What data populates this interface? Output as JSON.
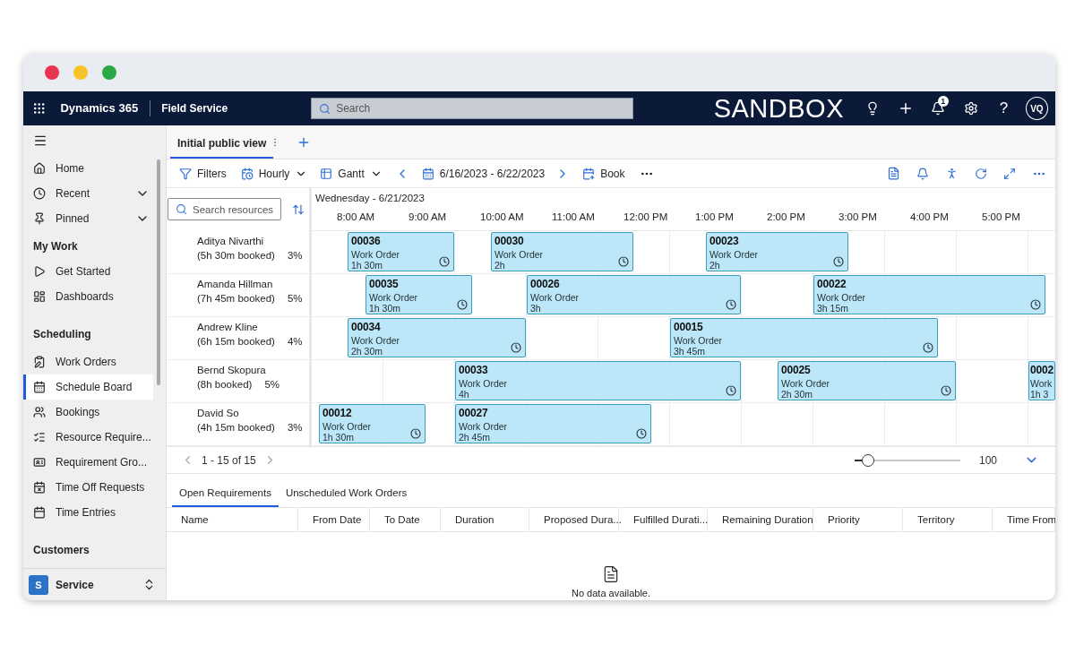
{
  "app_bar": {
    "product": "Dynamics 365",
    "app": "Field Service",
    "search": {
      "placeholder": "Search"
    },
    "environment": "SANDBOX",
    "notification_count": "1",
    "help": "?",
    "avatar": "VQ"
  },
  "sidebar": {
    "top_items": [
      {
        "label": "Home",
        "kind": "link",
        "selected": false
      },
      {
        "label": "Recent",
        "kind": "flyout",
        "expanded": false,
        "selected": false
      },
      {
        "label": "Pinned",
        "kind": "flyout",
        "expanded": false,
        "selected": false
      }
    ],
    "groups": [
      {
        "heading": "My Work",
        "items": [
          {
            "label": "Get Started",
            "selected": false
          },
          {
            "label": "Dashboards",
            "selected": false
          }
        ]
      },
      {
        "heading": "Scheduling",
        "items": [
          {
            "label": "Work Orders",
            "selected": false
          },
          {
            "label": "Schedule Board",
            "selected": true
          },
          {
            "label": "Bookings",
            "selected": false
          },
          {
            "label": "Resource Require...",
            "selected": false
          },
          {
            "label": "Requirement Gro...",
            "selected": false
          },
          {
            "label": "Time Off Requests",
            "selected": false
          },
          {
            "label": "Time Entries",
            "selected": false
          }
        ]
      },
      {
        "heading": "Customers"
      }
    ],
    "area": {
      "initial": "S",
      "label": "Service"
    }
  },
  "view_tabs": [
    {
      "label": "Initial public view",
      "selected": true
    }
  ],
  "toolbar": {
    "filters": "Filters",
    "period": "Hourly",
    "view": "Gantt",
    "date_range": "6/16/2023 - 6/22/2023",
    "book": "Book"
  },
  "board": {
    "search": {
      "placeholder": "Search resources"
    },
    "date": "Wednesday - 6/21/2023",
    "hours": [
      "8:00 AM",
      "9:00 AM",
      "10:00 AM",
      "11:00 AM",
      "12:00 PM",
      "1:00 PM",
      "2:00 PM",
      "3:00 PM",
      "4:00 PM",
      "5:00 PM"
    ],
    "resources": [
      {
        "name": "Aditya Nivarthi",
        "booked": "(5h 30m booked)",
        "utilization": "3%",
        "bookings": [
          {
            "number": "00036",
            "type": "Work Order",
            "duration": "1h 30m"
          },
          {
            "number": "00030",
            "type": "Work Order",
            "duration": "2h"
          },
          {
            "number": "00023",
            "type": "Work Order",
            "duration": "2h"
          }
        ]
      },
      {
        "name": "Amanda Hillman",
        "booked": "(7h 45m booked)",
        "utilization": "5%",
        "bookings": [
          {
            "number": "00035",
            "type": "Work Order",
            "duration": "1h 30m"
          },
          {
            "number": "00026",
            "type": "Work Order",
            "duration": "3h"
          },
          {
            "number": "00022",
            "type": "Work Order",
            "duration": "3h 15m"
          }
        ]
      },
      {
        "name": "Andrew Kline",
        "booked": "(6h 15m booked)",
        "utilization": "4%",
        "bookings": [
          {
            "number": "00034",
            "type": "Work Order",
            "duration": "2h 30m"
          },
          {
            "number": "00015",
            "type": "Work Order",
            "duration": "3h 45m"
          }
        ]
      },
      {
        "name": "Bernd Skopura",
        "booked": "(8h booked)",
        "utilization": "5%",
        "bookings": [
          {
            "number": "00033",
            "type": "Work Order",
            "duration": "4h"
          },
          {
            "number": "00025",
            "type": "Work Order",
            "duration": "2h 30m"
          },
          {
            "number": "0002",
            "type": "Work",
            "duration": "1h 3"
          }
        ]
      },
      {
        "name": "David So",
        "booked": "(4h 15m booked)",
        "utilization": "3%",
        "bookings": [
          {
            "number": "00012",
            "type": "Work Order",
            "duration": "1h 30m"
          },
          {
            "number": "00027",
            "type": "Work Order",
            "duration": "2h 45m"
          }
        ]
      }
    ]
  },
  "pager": {
    "range": "1 - 15 of 15",
    "zoom": {
      "level": 0.13,
      "value": "100"
    }
  },
  "requirements": {
    "tabs": [
      {
        "label": "Open Requirements",
        "selected": true
      },
      {
        "label": "Unscheduled Work Orders",
        "selected": false
      }
    ],
    "columns": [
      "Name",
      "From Date",
      "To Date",
      "Duration",
      "Proposed Dura...",
      "Fulfilled Durati...",
      "Remaining Duration",
      "Priority",
      "Territory",
      "Time From"
    ],
    "empty_text": "No data available."
  }
}
